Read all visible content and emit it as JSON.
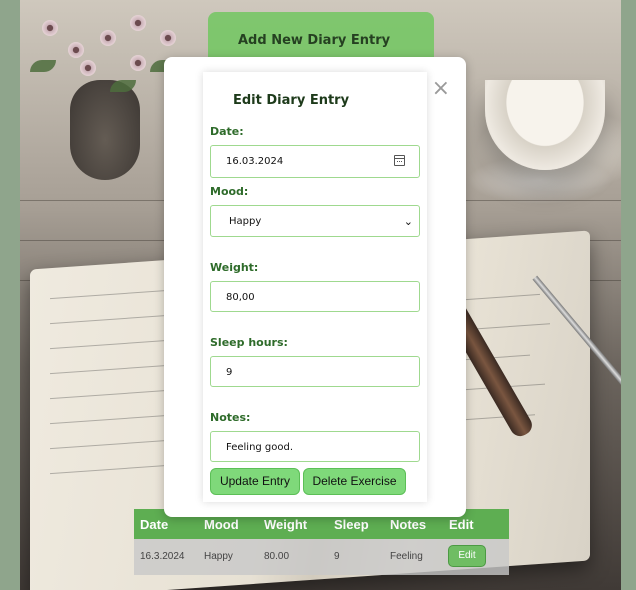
{
  "add_card": {
    "title": "Add New Diary Entry"
  },
  "modal": {
    "close_label": "×",
    "title": "Edit Diary Entry",
    "date": {
      "label": "Date:",
      "value": "16.03.2024"
    },
    "mood": {
      "label": "Mood:",
      "value": "Happy"
    },
    "weight": {
      "label": "Weight:",
      "value": "80,00"
    },
    "sleep": {
      "label": "Sleep hours:",
      "value": "9"
    },
    "notes": {
      "label": "Notes:",
      "value": "Feeling good."
    },
    "update_button": "Update Entry",
    "delete_button": "Delete Exercise"
  },
  "table": {
    "headers": [
      "Date",
      "Mood",
      "Weight",
      "Sleep",
      "Notes",
      "Edit"
    ],
    "rows": [
      {
        "date": "16.3.2024",
        "mood": "Happy",
        "weight": "80.00",
        "sleep": "9",
        "notes": "Feeling",
        "edit": "Edit"
      }
    ]
  },
  "colors": {
    "accent_green": "#7fd97a",
    "header_green": "#5eae52",
    "page_bg": "#8fa58c"
  }
}
